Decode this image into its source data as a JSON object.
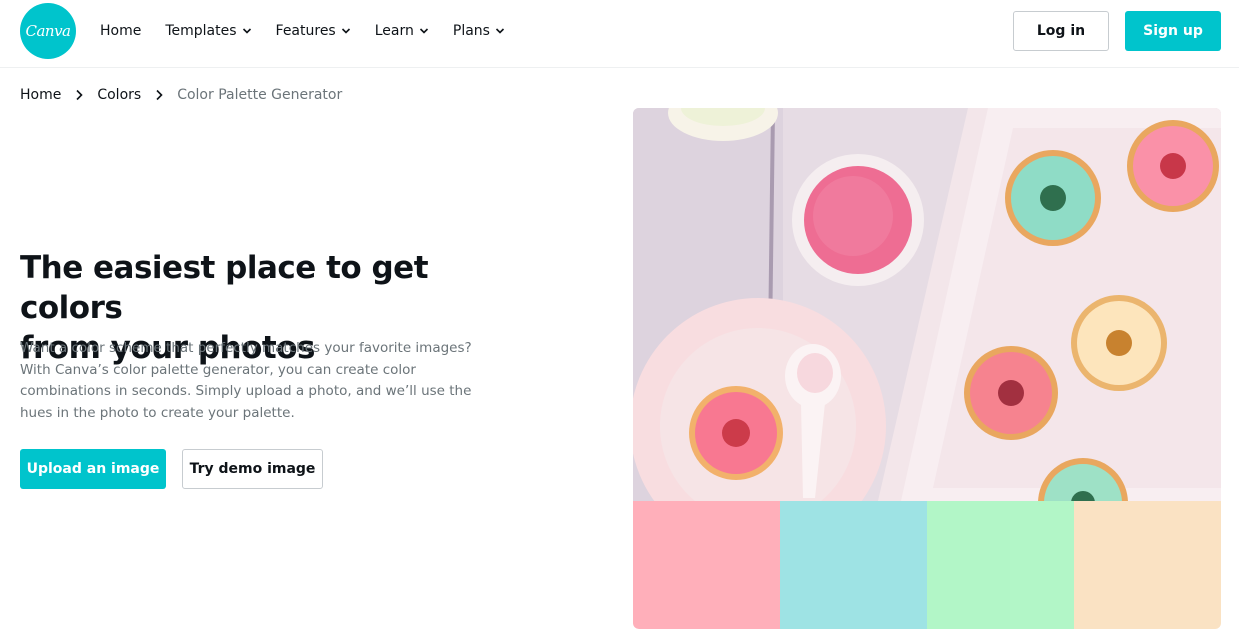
{
  "header": {
    "logo_text": "Canva",
    "nav": [
      {
        "label": "Home",
        "has_dropdown": false
      },
      {
        "label": "Templates",
        "has_dropdown": true
      },
      {
        "label": "Features",
        "has_dropdown": true
      },
      {
        "label": "Learn",
        "has_dropdown": true
      },
      {
        "label": "Plans",
        "has_dropdown": true
      }
    ],
    "login_label": "Log in",
    "signup_label": "Sign up"
  },
  "breadcrumb": [
    "Home",
    "Colors",
    "Color Palette Generator"
  ],
  "hero": {
    "title_line1": "The easiest place to get colors",
    "title_line2": "from your photos",
    "description": "Want a color scheme that perfectly matches your favorite images? With Canva’s color palette generator, you can create color combinations in seconds. Simply upload a photo, and we’ll use the hues in the photo to create your palette.",
    "upload_label": "Upload an image",
    "demo_label": "Try demo image"
  },
  "palette": {
    "swatches": [
      "#FFAFBA",
      "#9EE3E4",
      "#B2F6C7",
      "#FAE2C3"
    ]
  },
  "colors": {
    "accent": "#00C4CC",
    "text": "#0E1318",
    "muted": "#6B7479"
  }
}
